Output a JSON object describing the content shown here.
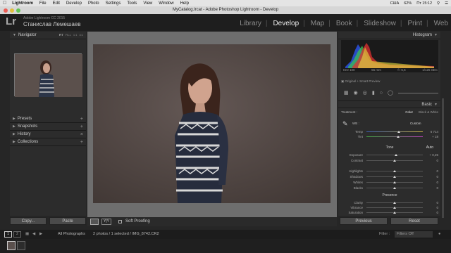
{
  "menubar": {
    "items": [
      "Lightroom",
      "File",
      "Edit",
      "Develop",
      "Photo",
      "Settings",
      "Tools",
      "View",
      "Window",
      "Help"
    ],
    "status": {
      "language": "США",
      "battery": "62%",
      "clock": "Пт 15:12"
    }
  },
  "window": {
    "title": "MyCatalog.lrcat - Adobe Photoshop Lightroom - Develop"
  },
  "identity": {
    "logo": "Lr",
    "app_name": "Adobe Lightroom CC 2015",
    "user": "Станислав Лемешаев"
  },
  "modules": [
    "Library",
    "Develop",
    "Map",
    "Book",
    "Slideshow",
    "Print",
    "Web"
  ],
  "left_panel": {
    "navigator": {
      "title": "Navigator",
      "zoom_options": [
        "FIT",
        "FILL",
        "1:1",
        "4:1"
      ],
      "selected": "FIT"
    },
    "sections": [
      "Presets",
      "Snapshots",
      "History",
      "Collections"
    ],
    "copy_label": "Copy...",
    "paste_label": "Paste"
  },
  "toolbar": {
    "soft_proofing": "Soft Proofing"
  },
  "right_panel": {
    "histogram_title": "Histogram",
    "histo_info": {
      "iso": "ISO 100",
      "focal": "55 mm",
      "aperture": "f / 5,6",
      "shutter": "1/125 SEC"
    },
    "preview_mode": "Original + Smart Preview",
    "basic_title": "Basic",
    "treatment_label": "Treatment :",
    "treatment_options": [
      "Color",
      "Black & White"
    ],
    "wb_label": "WB :",
    "wb_value": "Custom",
    "temp": {
      "label": "Temp",
      "value": "6 714",
      "fraction": 0.57
    },
    "tint": {
      "label": "Tint",
      "value": "+ 18",
      "fraction": 0.56
    },
    "tone_label": "Tone",
    "auto_label": "Auto",
    "exposure": {
      "label": "Exposure",
      "value": "+ 0,25",
      "fraction": 0.53
    },
    "contrast": {
      "label": "Contrast",
      "value": "0",
      "fraction": 0.5
    },
    "highlights": {
      "label": "Highlights",
      "value": "0",
      "fraction": 0.5
    },
    "shadows": {
      "label": "Shadows",
      "value": "0",
      "fraction": 0.5
    },
    "whites": {
      "label": "Whites",
      "value": "0",
      "fraction": 0.5
    },
    "blacks": {
      "label": "Blacks",
      "value": "0",
      "fraction": 0.5
    },
    "presence_label": "Presence",
    "clarity": {
      "label": "Clarity",
      "value": "0",
      "fraction": 0.5
    },
    "vibrance": {
      "label": "Vibrance",
      "value": "0",
      "fraction": 0.5
    },
    "saturation": {
      "label": "Saturation",
      "value": "0",
      "fraction": 0.5
    },
    "previous_label": "Previous",
    "reset_label": "Reset"
  },
  "filmstrip": {
    "source": "All Photographs",
    "selection_info": "2 photos / 1 selected / IMG_8742.CR2",
    "filter_label": "Filter :",
    "filter_value": "Filters Off",
    "page_numbers": [
      "1",
      "2"
    ]
  },
  "colors": {
    "accent": "#dddddd",
    "panel": "#2c2c2c"
  }
}
